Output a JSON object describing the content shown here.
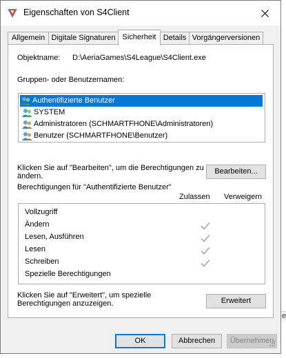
{
  "window": {
    "title": "Eigenschaften von S4Client"
  },
  "tabs": [
    {
      "label": "Allgemein",
      "active": false
    },
    {
      "label": "Digitale Signaturen",
      "active": false
    },
    {
      "label": "Sicherheit",
      "active": true
    },
    {
      "label": "Details",
      "active": false
    },
    {
      "label": "Vorgängerversionen",
      "active": false
    }
  ],
  "security": {
    "object_label": "Objektname:",
    "object_value": "D:\\AeriaGames\\S4League\\S4Client.exe",
    "groups_label": "Gruppen- oder Benutzernamen:",
    "groups": [
      {
        "name": "Authentifizierte Benutzer",
        "selected": true
      },
      {
        "name": "SYSTEM",
        "selected": false
      },
      {
        "name": "Administratoren (SCHMARTFHONE\\Administratoren)",
        "selected": false
      },
      {
        "name": "Benutzer (SCHMARTFHONE\\Benutzer)",
        "selected": false
      }
    ],
    "edit_hint_line1": "Klicken Sie auf \"Bearbeiten\", um die Berechtigungen zu",
    "edit_hint_line2": "ändern.",
    "edit_button": "Bearbeiten...",
    "permissions_for": "Berechtigungen für \"Authentifizierte Benutzer\"",
    "col_allow": "Zulassen",
    "col_deny": "Verweigern",
    "permissions": [
      {
        "name": "Vollzugriff",
        "allow": false,
        "deny": false
      },
      {
        "name": "Ändern",
        "allow": true,
        "deny": false
      },
      {
        "name": "Lesen, Ausführen",
        "allow": true,
        "deny": false
      },
      {
        "name": "Lesen",
        "allow": true,
        "deny": false
      },
      {
        "name": "Schreiben",
        "allow": true,
        "deny": false
      },
      {
        "name": "Spezielle Berechtigungen",
        "allow": false,
        "deny": false
      }
    ],
    "advanced_hint_line1": "Klicken Sie auf \"Erweitert\", um spezielle",
    "advanced_hint_line2": "Berechtigungen anzuzeigen.",
    "advanced_button": "Erweitert"
  },
  "footer": {
    "ok": "OK",
    "cancel": "Abbrechen",
    "apply": "Übernehmen"
  },
  "background": {
    "fragment": "e"
  },
  "colors": {
    "selection": "#0078d7",
    "check": "#b4b4b4",
    "window_bg": "#f0f0f0"
  }
}
